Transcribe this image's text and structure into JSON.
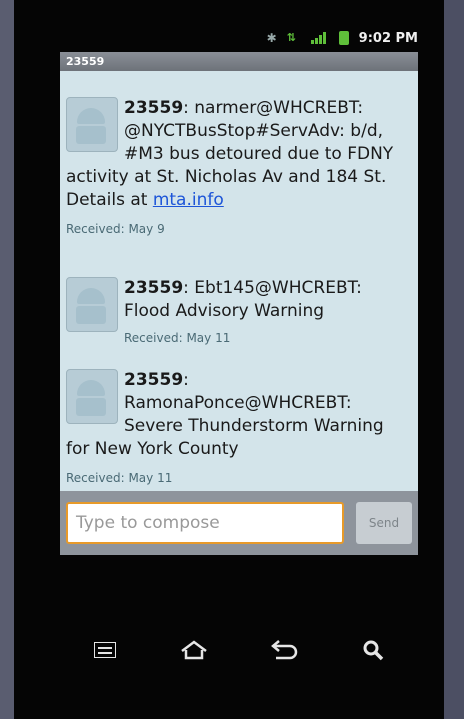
{
  "status_bar": {
    "time": "9:02 PM"
  },
  "conversation": {
    "title": "23559"
  },
  "messages": [
    {
      "sender": "23559",
      "text": ": narmer@WHCREBT: @NYCTBusStop#ServAdv: b/d, #M3 bus detoured due to FDNY activity at St. Nicholas Av and 184 St.  Details at ",
      "link": "mta.info",
      "received": "Received: May 9"
    },
    {
      "sender": "23559",
      "text": ": Ebt145@WHCREBT: Flood Advisory Warning",
      "received": "Received: May 11"
    },
    {
      "sender": "23559",
      "text": ": RamonaPonce@WHCREBT: Severe Thunderstorm Warning for New York County",
      "received": "Received: May 11"
    }
  ],
  "compose": {
    "placeholder": "Type to compose",
    "send_label": "Send"
  },
  "colors": {
    "accent_border": "#e79a2a",
    "link": "#1d55d8",
    "signal": "#5fbf3a"
  },
  "icons": [
    "bluetooth-icon",
    "network-icon",
    "signal-icon",
    "battery-icon",
    "menu-icon",
    "home-icon",
    "back-icon",
    "search-icon"
  ]
}
